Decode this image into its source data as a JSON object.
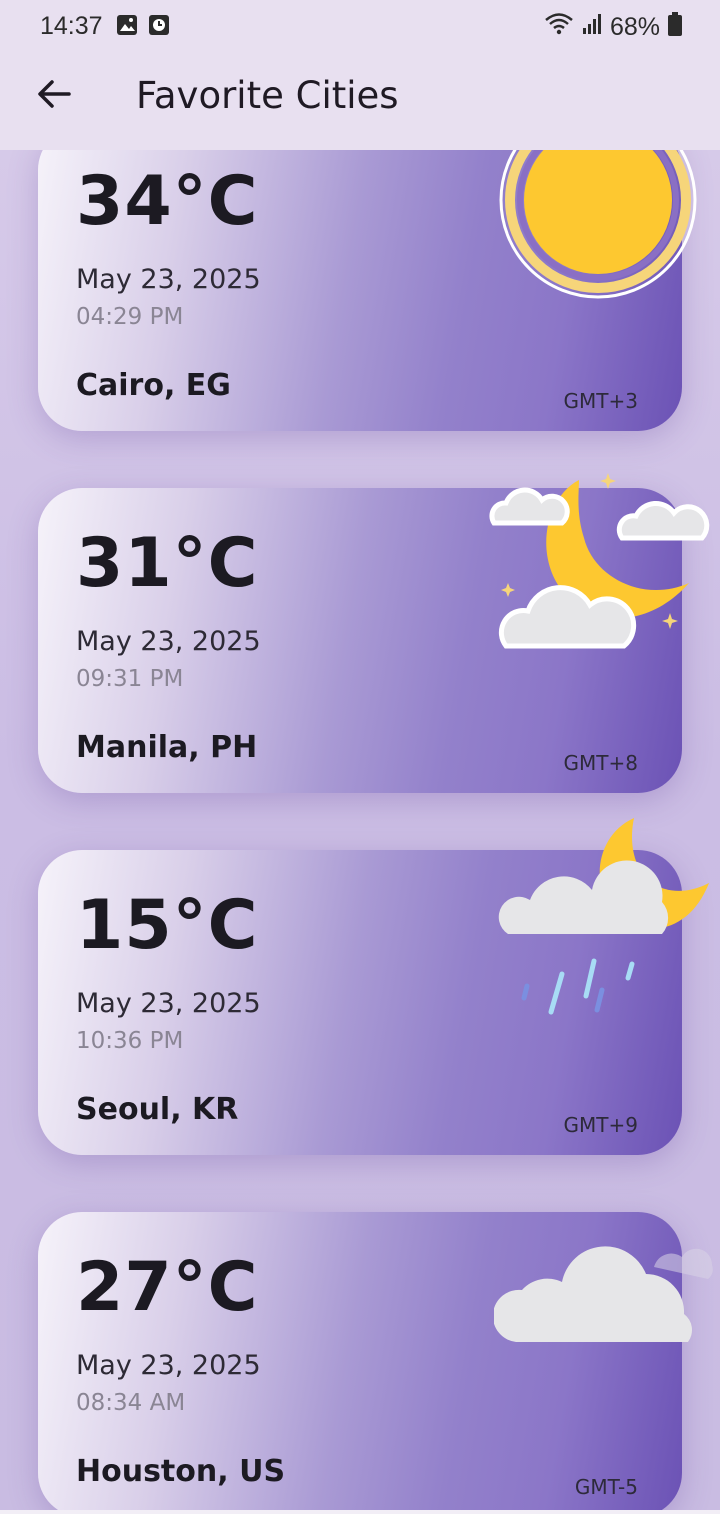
{
  "status_bar": {
    "time": "14:37",
    "battery": "68%",
    "icons": [
      "image-icon",
      "clock-app-icon",
      "wifi-icon",
      "signal-icon",
      "battery-icon"
    ]
  },
  "app_bar": {
    "title": "Favorite Cities",
    "back_icon": "arrow-left-icon"
  },
  "cities": [
    {
      "temp": "34°C",
      "date": "May 23, 2025",
      "time": "04:29 PM",
      "city": "Cairo, EG",
      "gmt": "GMT+3",
      "icon": "sun-icon"
    },
    {
      "temp": "31°C",
      "date": "May 23, 2025",
      "time": "09:31 PM",
      "city": "Manila, PH",
      "gmt": "GMT+8",
      "icon": "moon-clouds-icon"
    },
    {
      "temp": "15°C",
      "date": "May 23, 2025",
      "time": "10:36 PM",
      "city": "Seoul, KR",
      "gmt": "GMT+9",
      "icon": "moon-rain-icon"
    },
    {
      "temp": "27°C",
      "date": "May 23, 2025",
      "time": "08:34 AM",
      "city": "Houston, US",
      "gmt": "GMT-5",
      "icon": "cloud-icon"
    }
  ],
  "colors": {
    "appbar_bg": "#e8e0f0",
    "card_gradient_end": "#6b52b5",
    "sun": "#fdc830",
    "cloud": "#e6e6e8"
  }
}
